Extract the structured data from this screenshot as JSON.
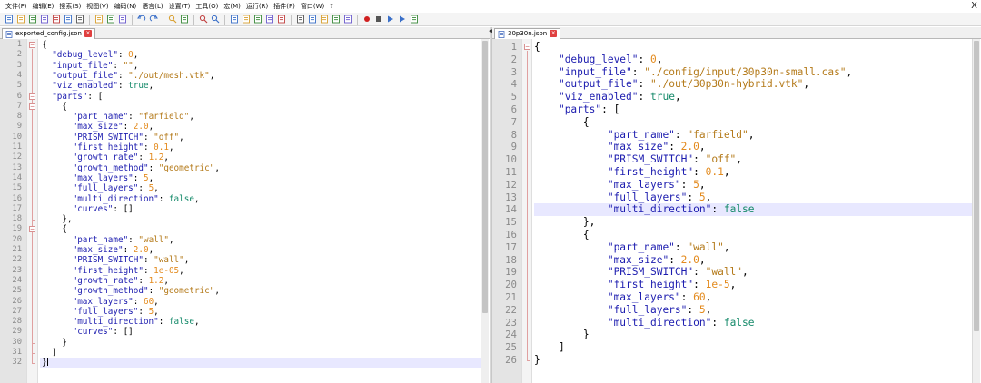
{
  "menu": [
    "文件(F)",
    "编辑(E)",
    "搜索(S)",
    "视图(V)",
    "编码(N)",
    "语言(L)",
    "设置(T)",
    "工具(O)",
    "宏(M)",
    "运行(R)",
    "插件(P)",
    "窗口(W)",
    "?"
  ],
  "window_close": "X",
  "toolbar": [
    "new-file-icon",
    "open-file-icon",
    "save-icon",
    "save-all-icon",
    "close-icon",
    "close-all-icon",
    "print-icon",
    "sep",
    "cut-icon",
    "copy-icon",
    "paste-icon",
    "sep",
    "undo-icon",
    "redo-icon",
    "sep",
    "find-icon",
    "replace-icon",
    "sep",
    "zoom-in-icon",
    "zoom-out-icon",
    "sep",
    "sync-vertical-icon",
    "sync-horizontal-icon",
    "word-wrap-icon",
    "show-all-chars-icon",
    "indent-guide-icon",
    "sep",
    "lang-icon",
    "doc-map-icon",
    "function-list-icon",
    "folder-icon",
    "monitor-icon",
    "sep",
    "record-macro-icon",
    "stop-macro-icon",
    "play-macro-icon",
    "run-macro-icon",
    "save-macro-icon"
  ],
  "colors": {
    "key": "#1c1caf",
    "string": "#b47a1a",
    "number": "#e38a1d",
    "boolean": "#158a6a",
    "current_line": "#e8e8ff",
    "gutter": "#e4e4e4"
  },
  "left": {
    "tab": "exported_config.json",
    "current_line": 32,
    "lines": [
      [
        [
          "p",
          "{"
        ]
      ],
      [
        [
          "p",
          "  "
        ],
        [
          "k",
          "\"debug_level\""
        ],
        [
          "p",
          ": "
        ],
        [
          "n",
          "0"
        ],
        [
          "p",
          ","
        ]
      ],
      [
        [
          "p",
          "  "
        ],
        [
          "k",
          "\"input_file\""
        ],
        [
          "p",
          ": "
        ],
        [
          "s",
          "\"\""
        ],
        [
          "p",
          ","
        ]
      ],
      [
        [
          "p",
          "  "
        ],
        [
          "k",
          "\"output_file\""
        ],
        [
          "p",
          ": "
        ],
        [
          "s",
          "\"./out/mesh.vtk\""
        ],
        [
          "p",
          ","
        ]
      ],
      [
        [
          "p",
          "  "
        ],
        [
          "k",
          "\"viz_enabled\""
        ],
        [
          "p",
          ": "
        ],
        [
          "b",
          "true"
        ],
        [
          "p",
          ","
        ]
      ],
      [
        [
          "p",
          "  "
        ],
        [
          "k",
          "\"parts\""
        ],
        [
          "p",
          ": ["
        ]
      ],
      [
        [
          "p",
          "    {"
        ]
      ],
      [
        [
          "p",
          "      "
        ],
        [
          "k",
          "\"part_name\""
        ],
        [
          "p",
          ": "
        ],
        [
          "s",
          "\"farfield\""
        ],
        [
          "p",
          ","
        ]
      ],
      [
        [
          "p",
          "      "
        ],
        [
          "k",
          "\"max_size\""
        ],
        [
          "p",
          ": "
        ],
        [
          "n",
          "2.0"
        ],
        [
          "p",
          ","
        ]
      ],
      [
        [
          "p",
          "      "
        ],
        [
          "k",
          "\"PRISM_SWITCH\""
        ],
        [
          "p",
          ": "
        ],
        [
          "s",
          "\"off\""
        ],
        [
          "p",
          ","
        ]
      ],
      [
        [
          "p",
          "      "
        ],
        [
          "k",
          "\"first_height\""
        ],
        [
          "p",
          ": "
        ],
        [
          "n",
          "0.1"
        ],
        [
          "p",
          ","
        ]
      ],
      [
        [
          "p",
          "      "
        ],
        [
          "k",
          "\"growth_rate\""
        ],
        [
          "p",
          ": "
        ],
        [
          "n",
          "1.2"
        ],
        [
          "p",
          ","
        ]
      ],
      [
        [
          "p",
          "      "
        ],
        [
          "k",
          "\"growth_method\""
        ],
        [
          "p",
          ": "
        ],
        [
          "s",
          "\"geometric\""
        ],
        [
          "p",
          ","
        ]
      ],
      [
        [
          "p",
          "      "
        ],
        [
          "k",
          "\"max_layers\""
        ],
        [
          "p",
          ": "
        ],
        [
          "n",
          "5"
        ],
        [
          "p",
          ","
        ]
      ],
      [
        [
          "p",
          "      "
        ],
        [
          "k",
          "\"full_layers\""
        ],
        [
          "p",
          ": "
        ],
        [
          "n",
          "5"
        ],
        [
          "p",
          ","
        ]
      ],
      [
        [
          "p",
          "      "
        ],
        [
          "k",
          "\"multi_direction\""
        ],
        [
          "p",
          ": "
        ],
        [
          "b",
          "false"
        ],
        [
          "p",
          ","
        ]
      ],
      [
        [
          "p",
          "      "
        ],
        [
          "k",
          "\"curves\""
        ],
        [
          "p",
          ": []"
        ]
      ],
      [
        [
          "p",
          "    },"
        ]
      ],
      [
        [
          "p",
          "    {"
        ]
      ],
      [
        [
          "p",
          "      "
        ],
        [
          "k",
          "\"part_name\""
        ],
        [
          "p",
          ": "
        ],
        [
          "s",
          "\"wall\""
        ],
        [
          "p",
          ","
        ]
      ],
      [
        [
          "p",
          "      "
        ],
        [
          "k",
          "\"max_size\""
        ],
        [
          "p",
          ": "
        ],
        [
          "n",
          "2.0"
        ],
        [
          "p",
          ","
        ]
      ],
      [
        [
          "p",
          "      "
        ],
        [
          "k",
          "\"PRISM_SWITCH\""
        ],
        [
          "p",
          ": "
        ],
        [
          "s",
          "\"wall\""
        ],
        [
          "p",
          ","
        ]
      ],
      [
        [
          "p",
          "      "
        ],
        [
          "k",
          "\"first_height\""
        ],
        [
          "p",
          ": "
        ],
        [
          "n",
          "1e-05"
        ],
        [
          "p",
          ","
        ]
      ],
      [
        [
          "p",
          "      "
        ],
        [
          "k",
          "\"growth_rate\""
        ],
        [
          "p",
          ": "
        ],
        [
          "n",
          "1.2"
        ],
        [
          "p",
          ","
        ]
      ],
      [
        [
          "p",
          "      "
        ],
        [
          "k",
          "\"growth_method\""
        ],
        [
          "p",
          ": "
        ],
        [
          "s",
          "\"geometric\""
        ],
        [
          "p",
          ","
        ]
      ],
      [
        [
          "p",
          "      "
        ],
        [
          "k",
          "\"max_layers\""
        ],
        [
          "p",
          ": "
        ],
        [
          "n",
          "60"
        ],
        [
          "p",
          ","
        ]
      ],
      [
        [
          "p",
          "      "
        ],
        [
          "k",
          "\"full_layers\""
        ],
        [
          "p",
          ": "
        ],
        [
          "n",
          "5"
        ],
        [
          "p",
          ","
        ]
      ],
      [
        [
          "p",
          "      "
        ],
        [
          "k",
          "\"multi_direction\""
        ],
        [
          "p",
          ": "
        ],
        [
          "b",
          "false"
        ],
        [
          "p",
          ","
        ]
      ],
      [
        [
          "p",
          "      "
        ],
        [
          "k",
          "\"curves\""
        ],
        [
          "p",
          ": []"
        ]
      ],
      [
        [
          "p",
          "    }"
        ]
      ],
      [
        [
          "p",
          "  ]"
        ]
      ],
      [
        [
          "p",
          "}"
        ]
      ]
    ],
    "folds": [
      [
        1,
        32
      ],
      [
        6,
        31
      ],
      [
        7,
        18
      ],
      [
        19,
        30
      ]
    ]
  },
  "right": {
    "tab": "30p30n.json",
    "current_line": 14,
    "lines": [
      [
        [
          "p",
          "{"
        ]
      ],
      [
        [
          "p",
          "    "
        ],
        [
          "k",
          "\"debug_level\""
        ],
        [
          "p",
          ": "
        ],
        [
          "n",
          "0"
        ],
        [
          "p",
          ","
        ]
      ],
      [
        [
          "p",
          "    "
        ],
        [
          "k",
          "\"input_file\""
        ],
        [
          "p",
          ": "
        ],
        [
          "s",
          "\"./config/input/30p30n-small.cas\""
        ],
        [
          "p",
          ","
        ]
      ],
      [
        [
          "p",
          "    "
        ],
        [
          "k",
          "\"output_file\""
        ],
        [
          "p",
          ": "
        ],
        [
          "s",
          "\"./out/30p30n-hybrid.vtk\""
        ],
        [
          "p",
          ","
        ]
      ],
      [
        [
          "p",
          "    "
        ],
        [
          "k",
          "\"viz_enabled\""
        ],
        [
          "p",
          ": "
        ],
        [
          "b",
          "true"
        ],
        [
          "p",
          ","
        ]
      ],
      [
        [
          "p",
          "    "
        ],
        [
          "k",
          "\"parts\""
        ],
        [
          "p",
          ": ["
        ]
      ],
      [
        [
          "p",
          "        {"
        ]
      ],
      [
        [
          "p",
          "            "
        ],
        [
          "k",
          "\"part_name\""
        ],
        [
          "p",
          ": "
        ],
        [
          "s",
          "\"farfield\""
        ],
        [
          "p",
          ","
        ]
      ],
      [
        [
          "p",
          "            "
        ],
        [
          "k",
          "\"max_size\""
        ],
        [
          "p",
          ": "
        ],
        [
          "n",
          "2.0"
        ],
        [
          "p",
          ","
        ]
      ],
      [
        [
          "p",
          "            "
        ],
        [
          "k",
          "\"PRISM_SWITCH\""
        ],
        [
          "p",
          ": "
        ],
        [
          "s",
          "\"off\""
        ],
        [
          "p",
          ","
        ]
      ],
      [
        [
          "p",
          "            "
        ],
        [
          "k",
          "\"first_height\""
        ],
        [
          "p",
          ": "
        ],
        [
          "n",
          "0.1"
        ],
        [
          "p",
          ","
        ]
      ],
      [
        [
          "p",
          "            "
        ],
        [
          "k",
          "\"max_layers\""
        ],
        [
          "p",
          ": "
        ],
        [
          "n",
          "5"
        ],
        [
          "p",
          ","
        ]
      ],
      [
        [
          "p",
          "            "
        ],
        [
          "k",
          "\"full_layers\""
        ],
        [
          "p",
          ": "
        ],
        [
          "n",
          "5"
        ],
        [
          "p",
          ","
        ]
      ],
      [
        [
          "p",
          "            "
        ],
        [
          "k",
          "\"multi_direction\""
        ],
        [
          "p",
          ": "
        ],
        [
          "b",
          "false"
        ]
      ],
      [
        [
          "p",
          "        },"
        ]
      ],
      [
        [
          "p",
          "        {"
        ]
      ],
      [
        [
          "p",
          "            "
        ],
        [
          "k",
          "\"part_name\""
        ],
        [
          "p",
          ": "
        ],
        [
          "s",
          "\"wall\""
        ],
        [
          "p",
          ","
        ]
      ],
      [
        [
          "p",
          "            "
        ],
        [
          "k",
          "\"max_size\""
        ],
        [
          "p",
          ": "
        ],
        [
          "n",
          "2.0"
        ],
        [
          "p",
          ","
        ]
      ],
      [
        [
          "p",
          "            "
        ],
        [
          "k",
          "\"PRISM_SWITCH\""
        ],
        [
          "p",
          ": "
        ],
        [
          "s",
          "\"wall\""
        ],
        [
          "p",
          ","
        ]
      ],
      [
        [
          "p",
          "            "
        ],
        [
          "k",
          "\"first_height\""
        ],
        [
          "p",
          ": "
        ],
        [
          "n",
          "1e-5"
        ],
        [
          "p",
          ","
        ]
      ],
      [
        [
          "p",
          "            "
        ],
        [
          "k",
          "\"max_layers\""
        ],
        [
          "p",
          ": "
        ],
        [
          "n",
          "60"
        ],
        [
          "p",
          ","
        ]
      ],
      [
        [
          "p",
          "            "
        ],
        [
          "k",
          "\"full_layers\""
        ],
        [
          "p",
          ": "
        ],
        [
          "n",
          "5"
        ],
        [
          "p",
          ","
        ]
      ],
      [
        [
          "p",
          "            "
        ],
        [
          "k",
          "\"multi_direction\""
        ],
        [
          "p",
          ": "
        ],
        [
          "b",
          "false"
        ]
      ],
      [
        [
          "p",
          "        }"
        ]
      ],
      [
        [
          "p",
          "    ]"
        ]
      ],
      [
        [
          "p",
          "}"
        ]
      ]
    ],
    "folds": [
      [
        1,
        26
      ]
    ]
  }
}
